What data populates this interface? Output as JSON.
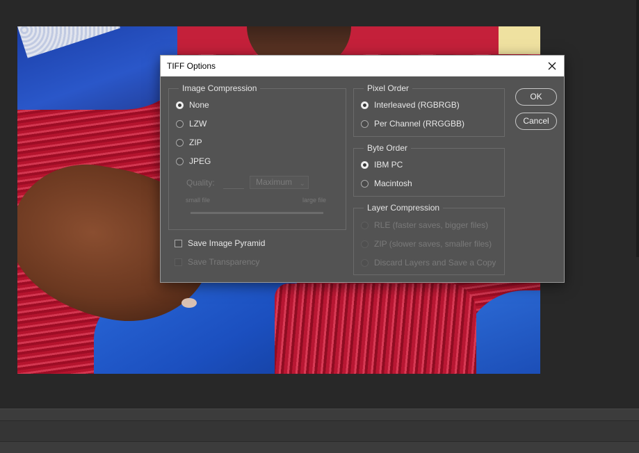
{
  "dialog": {
    "title": "TIFF Options",
    "close_icon": "close-icon"
  },
  "image_compression": {
    "legend": "Image Compression",
    "options": [
      {
        "label": "None",
        "selected": true
      },
      {
        "label": "LZW",
        "selected": false
      },
      {
        "label": "ZIP",
        "selected": false
      },
      {
        "label": "JPEG",
        "selected": false
      }
    ],
    "quality_label": "Quality:",
    "quality_value": "",
    "quality_select": "Maximum",
    "small_file": "small file",
    "large_file": "large file"
  },
  "pixel_order": {
    "legend": "Pixel Order",
    "options": [
      {
        "label": "Interleaved (RGBRGB)",
        "selected": true
      },
      {
        "label": "Per Channel (RRGGBB)",
        "selected": false
      }
    ]
  },
  "byte_order": {
    "legend": "Byte Order",
    "options": [
      {
        "label": "IBM PC",
        "selected": true
      },
      {
        "label": "Macintosh",
        "selected": false
      }
    ]
  },
  "layer_compression": {
    "legend": "Layer Compression",
    "options": [
      {
        "label": "RLE (faster saves, bigger files)",
        "enabled": false
      },
      {
        "label": "ZIP (slower saves, smaller files)",
        "enabled": false
      },
      {
        "label": "Discard Layers and Save a Copy",
        "enabled": false
      }
    ]
  },
  "checkboxes": {
    "save_image_pyramid": "Save Image Pyramid",
    "save_transparency": "Save Transparency"
  },
  "buttons": {
    "ok": "OK",
    "cancel": "Cancel"
  },
  "colors": {
    "dialog_bg": "#535353",
    "titlebar_bg": "#ffffff",
    "workspace_bg": "#282828"
  }
}
